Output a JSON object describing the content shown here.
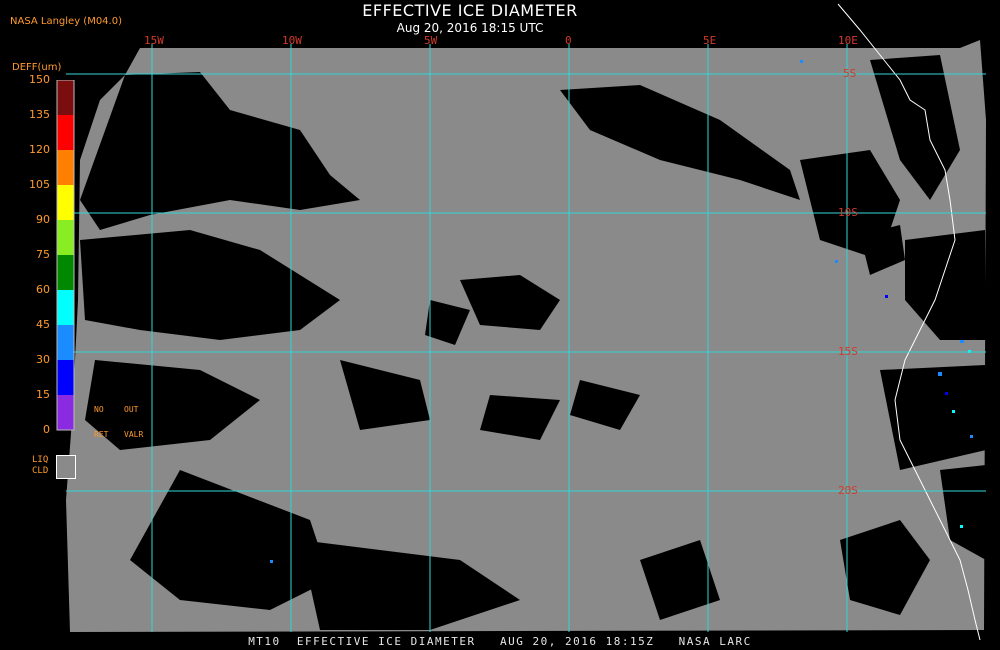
{
  "header": {
    "credit": "NASA Langley (M04.0)",
    "title": "EFFECTIVE ICE DIAMETER",
    "subtitle": "Aug 20, 2016 18:15 UTC"
  },
  "map": {
    "longitude_labels": [
      "15W",
      "10W",
      "5W",
      "0",
      "5E",
      "10E"
    ],
    "latitude_labels": [
      "5S",
      "10S",
      "15S",
      "20S"
    ],
    "grid_color": "#33d6d6",
    "label_color": "#d23a2a",
    "clear_color": "#000000",
    "liquid_cloud_color": "#8a8a8a",
    "coastline_color": "#ffffff"
  },
  "colorbar": {
    "label": "DEFF(um)",
    "ticks": [
      "150",
      "135",
      "120",
      "105",
      "90",
      "75",
      "60",
      "45",
      "30",
      "15",
      "0"
    ],
    "colors": [
      "#7a0e0e",
      "#ff0000",
      "#ff8000",
      "#ffff00",
      "#88ee22",
      "#008800",
      "#00ffff",
      "#1a8cff",
      "#0000ff",
      "#8a2be2"
    ],
    "no_ret": [
      "NO",
      "RET"
    ],
    "out_valr": [
      "OUT",
      "VALR"
    ],
    "liq_cld": [
      "LIQ",
      "CLD"
    ]
  },
  "footer": "MT10  EFFECTIVE ICE DIAMETER   AUG 20, 2016 18:15Z   NASA LARC"
}
